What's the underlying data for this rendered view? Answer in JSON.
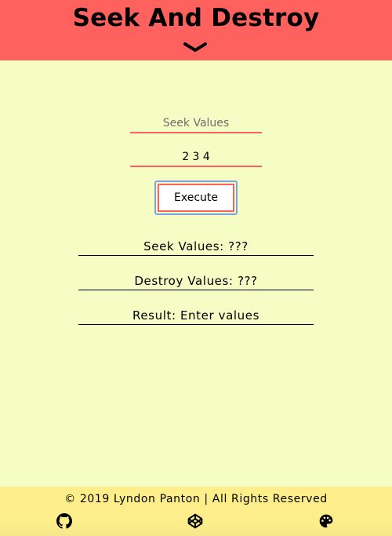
{
  "header": {
    "title": "Seek And Destroy",
    "toggle_icon": "chevron-down-icon",
    "background_color": "#ff625e"
  },
  "form": {
    "seek_field": {
      "placeholder": "Seek Values",
      "value": ""
    },
    "destroy_field": {
      "placeholder": "",
      "value": "2 3 4"
    },
    "execute_label": "Execute",
    "accent_color": "#ff625e"
  },
  "outputs": {
    "seek_values": "Seek Values: ???",
    "destroy_values": "Destroy Values: ???",
    "result": "Result: Enter values"
  },
  "footer": {
    "copyright": "© 2019 Lyndon Panton | All Rights Reserved",
    "icons": [
      "github-icon",
      "codepen-icon",
      "palette-icon"
    ],
    "background_color": "#fdee8c"
  },
  "page": {
    "background_color": "#f5fdc4"
  }
}
